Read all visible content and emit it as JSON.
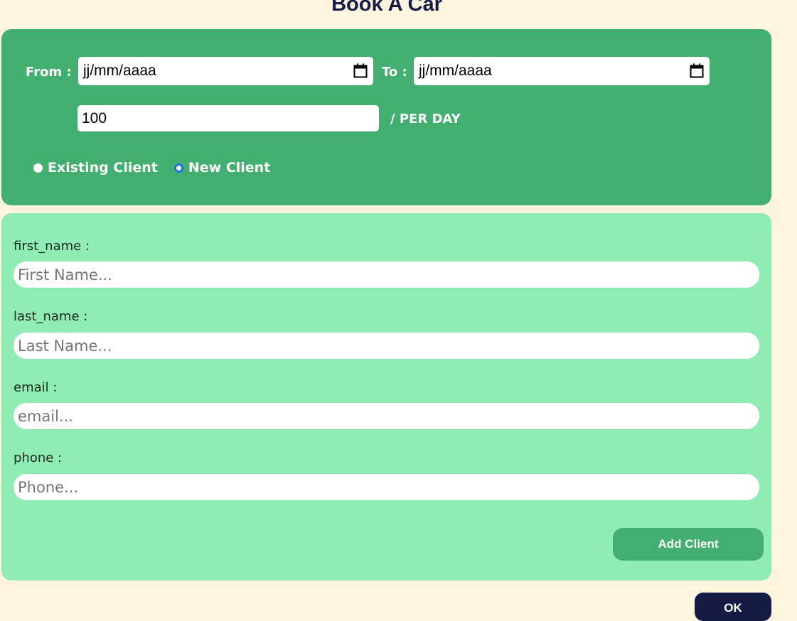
{
  "title": "Book A Car",
  "booking": {
    "from_label": "From :",
    "from_value": "jj/mm/aaaa",
    "to_label": "To :",
    "to_value": "jj/mm/aaaa",
    "price_value": "100",
    "per_day_label": "/ PER DAY",
    "client_options": [
      {
        "label": "Existing Client",
        "selected": false
      },
      {
        "label": "New Client",
        "selected": true
      }
    ]
  },
  "client_form": {
    "fields": [
      {
        "label": "first_name :",
        "placeholder": "First Name..."
      },
      {
        "label": "last_name :",
        "placeholder": "Last Name..."
      },
      {
        "label": "email :",
        "placeholder": "email..."
      },
      {
        "label": "phone :",
        "placeholder": "Phone..."
      }
    ],
    "add_button": "Add Client"
  },
  "ok_button": "OK",
  "colors": {
    "background": "#fff4e0",
    "booking_panel": "#42ae6f",
    "client_panel": "#8eecb4",
    "title": "#151c46",
    "ok_button": "#151c46",
    "radio_selected": "#1a73e8"
  },
  "icons": {
    "date_picker": "calendar-icon"
  }
}
